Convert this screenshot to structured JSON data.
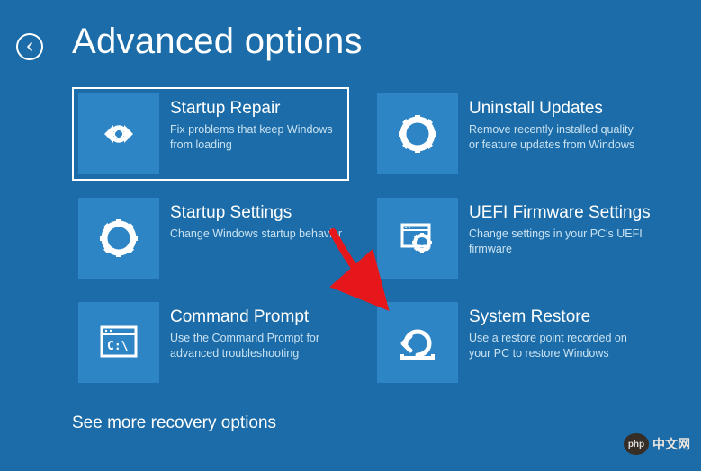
{
  "page_title": "Advanced options",
  "tiles": [
    {
      "title": "Startup Repair",
      "desc": "Fix problems that keep Windows from loading"
    },
    {
      "title": "Uninstall Updates",
      "desc": "Remove recently installed quality or feature updates from Windows"
    },
    {
      "title": "Startup Settings",
      "desc": "Change Windows startup behavior"
    },
    {
      "title": "UEFI Firmware Settings",
      "desc": "Change settings in your PC's UEFI firmware"
    },
    {
      "title": "Command Prompt",
      "desc": "Use the Command Prompt for advanced troubleshooting"
    },
    {
      "title": "System Restore",
      "desc": "Use a restore point recorded on your PC to restore Windows"
    }
  ],
  "more_options": "See more recovery options",
  "watermark": "中文网"
}
